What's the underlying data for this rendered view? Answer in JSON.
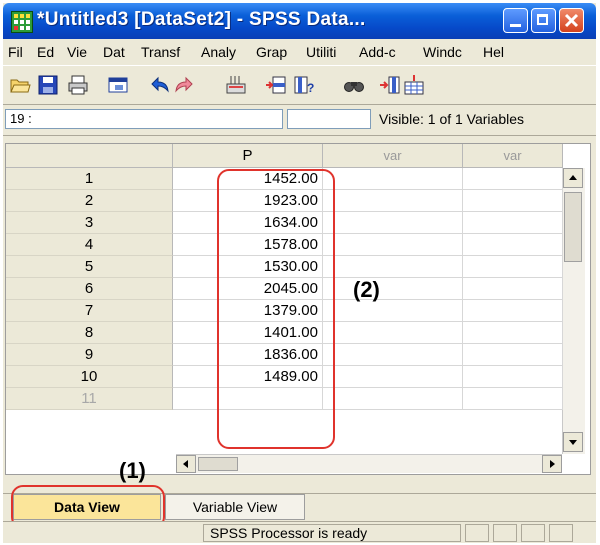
{
  "window": {
    "title": "*Untitled3 [DataSet2] - SPSS Data...",
    "buttons": {
      "minimize": "minimize-icon",
      "maximize": "maximize-icon",
      "close": "close-icon"
    }
  },
  "menubar": {
    "items": [
      "File",
      "Edit",
      "View",
      "Data",
      "Transform",
      "Analyze",
      "Graphs",
      "Utilities",
      "Add-ons",
      "Window",
      "Help"
    ],
    "visible_labels": [
      "Fil",
      "Ed",
      "Vie",
      "Dat",
      "Transf",
      "Analy",
      "Grap",
      "Utiliti",
      "Add-c",
      "Windc",
      "Hel"
    ]
  },
  "toolbar": {
    "icons": [
      "open-folder-icon",
      "save-icon",
      "print-icon",
      "dialog-recall-icon",
      "undo-icon",
      "redo-icon",
      "goto-case-icon",
      "insert-cases-icon",
      "variables-icon",
      "find-icon",
      "insert-variable-icon",
      "split-file-icon"
    ]
  },
  "editor": {
    "cell_ref": "19 :",
    "cell_value": "",
    "visible_info": "Visible: 1 of 1 Variables"
  },
  "grid": {
    "columns": [
      {
        "label": "P",
        "is_var": false
      },
      {
        "label": "var",
        "is_var": true
      },
      {
        "label": "var",
        "is_var": true
      }
    ],
    "rows": [
      {
        "num": "1",
        "p": "1452.00"
      },
      {
        "num": "2",
        "p": "1923.00"
      },
      {
        "num": "3",
        "p": "1634.00"
      },
      {
        "num": "4",
        "p": "1578.00"
      },
      {
        "num": "5",
        "p": "1530.00"
      },
      {
        "num": "6",
        "p": "2045.00"
      },
      {
        "num": "7",
        "p": "1379.00"
      },
      {
        "num": "8",
        "p": "1401.00"
      },
      {
        "num": "9",
        "p": "1836.00"
      },
      {
        "num": "10",
        "p": "1489.00"
      },
      {
        "num": "11",
        "p": ""
      }
    ]
  },
  "tabs": [
    {
      "label": "Data View",
      "active": true
    },
    {
      "label": "Variable View",
      "active": false
    }
  ],
  "status": {
    "text": "SPSS  Processor is ready"
  },
  "annotations": {
    "label1": "(1)",
    "label2": "(2)"
  },
  "colors": {
    "highlight_red": "#e0332c",
    "active_tab": "#fbe59a",
    "titlebar_blue": "#0649c9"
  }
}
